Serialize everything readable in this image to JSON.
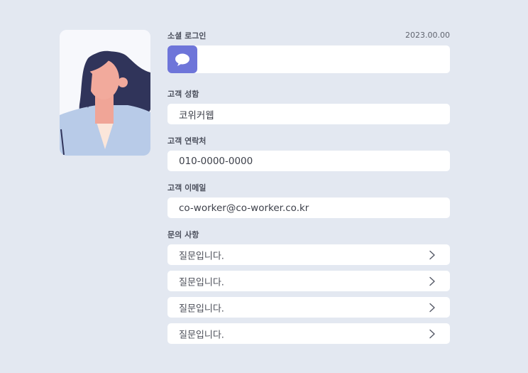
{
  "social_login": {
    "label": "소셜 로그인",
    "date": "2023.00.00",
    "icon": "chat-bubble-icon",
    "icon_color": "#6e75d9"
  },
  "customer": {
    "name_label": "고객 성함",
    "name_value": "코위커웹",
    "phone_label": "고객 연락처",
    "phone_value": "010-0000-0000",
    "email_label": "고객 이메일",
    "email_value": "co-worker@co-worker.co.kr"
  },
  "inquiries": {
    "label": "문의 사항",
    "items": [
      {
        "text": "질문입니다.",
        "icon": "chevron-right-icon"
      },
      {
        "text": "질문입니다.",
        "icon": "chevron-right-icon"
      },
      {
        "text": "질문입니다.",
        "icon": "chevron-right-icon"
      },
      {
        "text": "질문입니다.",
        "icon": "chevron-right-icon"
      }
    ]
  },
  "colors": {
    "background": "#e3e8f1",
    "card": "#ffffff",
    "accent": "#6e75d9"
  }
}
